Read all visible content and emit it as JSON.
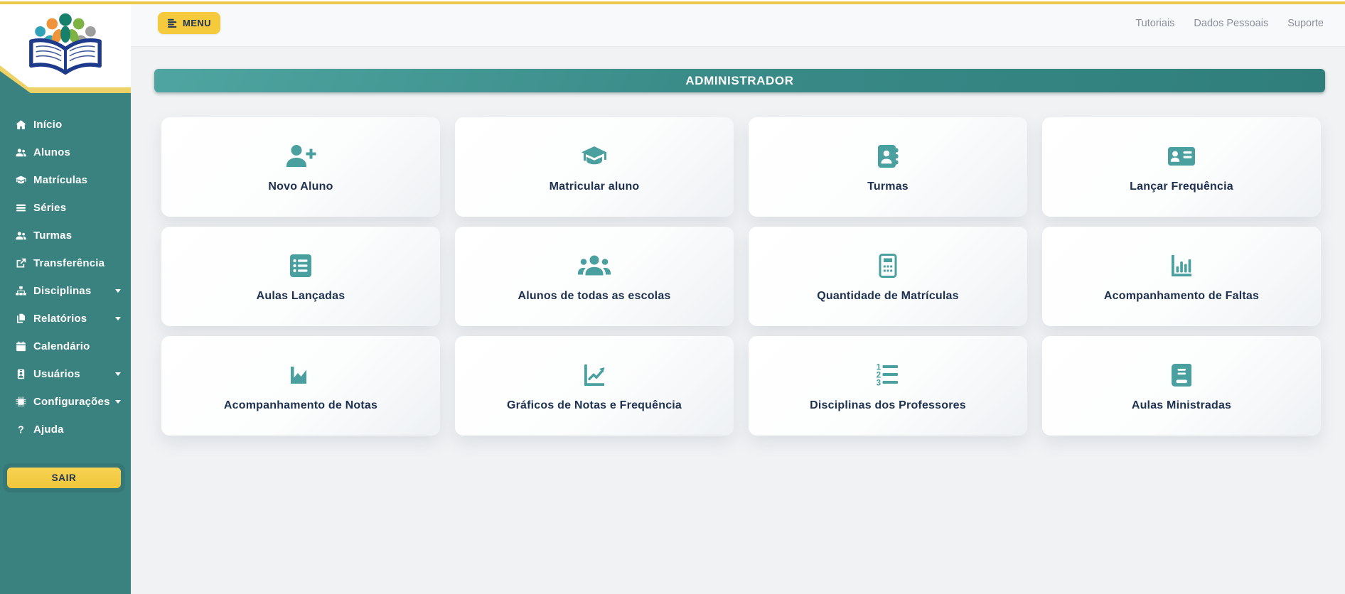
{
  "topbar": {
    "menu_label": "MENU",
    "links": [
      {
        "label": "Tutoriais"
      },
      {
        "label": "Dados Pessoais"
      },
      {
        "label": "Suporte"
      }
    ]
  },
  "header": {
    "title": "ADMINISTRADOR"
  },
  "sidebar": {
    "items": [
      {
        "label": "Início",
        "icon": "home",
        "caret": false
      },
      {
        "label": "Alunos",
        "icon": "users",
        "caret": false
      },
      {
        "label": "Matrículas",
        "icon": "graduation-cap",
        "caret": false
      },
      {
        "label": "Séries",
        "icon": "list",
        "caret": false
      },
      {
        "label": "Turmas",
        "icon": "users",
        "caret": false
      },
      {
        "label": "Transferência",
        "icon": "share-square",
        "caret": false
      },
      {
        "label": "Disciplinas",
        "icon": "sitemap",
        "caret": true
      },
      {
        "label": "Relatórios",
        "icon": "copy",
        "caret": true
      },
      {
        "label": "Calendário",
        "icon": "calendar",
        "caret": false
      },
      {
        "label": "Usuários",
        "icon": "id-badge",
        "caret": true
      },
      {
        "label": "Configurações",
        "icon": "microchip",
        "caret": true
      },
      {
        "label": "Ajuda",
        "icon": "question",
        "caret": false
      }
    ],
    "logout_label": "SAIR"
  },
  "cards": [
    {
      "label": "Novo Aluno",
      "icon": "user-plus"
    },
    {
      "label": "Matricular aluno",
      "icon": "graduation-cap"
    },
    {
      "label": "Turmas",
      "icon": "address-book"
    },
    {
      "label": "Lançar Frequência",
      "icon": "address-card"
    },
    {
      "label": "Aulas Lançadas",
      "icon": "list-alt"
    },
    {
      "label": "Alunos de todas as escolas",
      "icon": "users-group"
    },
    {
      "label": "Quantidade de Matrículas",
      "icon": "calculator"
    },
    {
      "label": "Acompanhamento de Faltas",
      "icon": "chart-bar"
    },
    {
      "label": "Acompanhamento de Notas",
      "icon": "chart-area"
    },
    {
      "label": "Gráficos de Notas e Frequência",
      "icon": "chart-line"
    },
    {
      "label": "Disciplinas dos Professores",
      "icon": "list-ol"
    },
    {
      "label": "Aulas Ministradas",
      "icon": "book"
    }
  ],
  "colors": {
    "sidebar_teal": "#3A8280",
    "accent_teal": "#4AA09F",
    "yellow": "#F5CB3D",
    "navy": "#1E3150"
  }
}
